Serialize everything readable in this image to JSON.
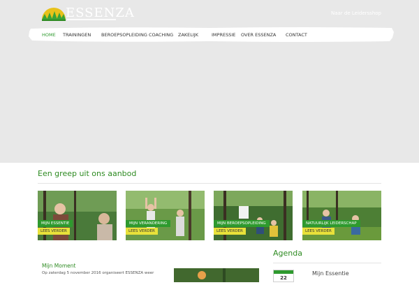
{
  "header": {
    "logo_text": "ESSENZA",
    "top_right_text": "Naar de Leidersshop"
  },
  "nav": {
    "items": [
      {
        "label": "HOME"
      },
      {
        "label": "TRAININGEN"
      },
      {
        "label": "BEROEPSOPLEIDING"
      },
      {
        "label": "COACHING"
      },
      {
        "label": "ZAKELIJK"
      },
      {
        "label": "IMPRESSIE"
      },
      {
        "label": "OVER ESSENZA"
      },
      {
        "label": "CONTACT"
      }
    ]
  },
  "offer": {
    "title": "Een greep uit ons aanbod",
    "cards": [
      {
        "tag": "MIJN ESSENTIE",
        "button": "LEES VERDER"
      },
      {
        "tag": "MIJN VERANDERING",
        "button": "LEES VERDER"
      },
      {
        "tag": "MIJN BEROEPSOPLEIDING",
        "button": "LEES VERDER"
      },
      {
        "tag": "NATUURLIJK LEIDERSCHAP",
        "button": "LEES VERDER"
      }
    ]
  },
  "article": {
    "title": "Mijn Moment",
    "text": "Op zaterdag 5 november 2016 organiseert ESSENZA weer"
  },
  "agenda": {
    "title": "Agenda",
    "day": "22",
    "item": "Mijn Essentie"
  }
}
